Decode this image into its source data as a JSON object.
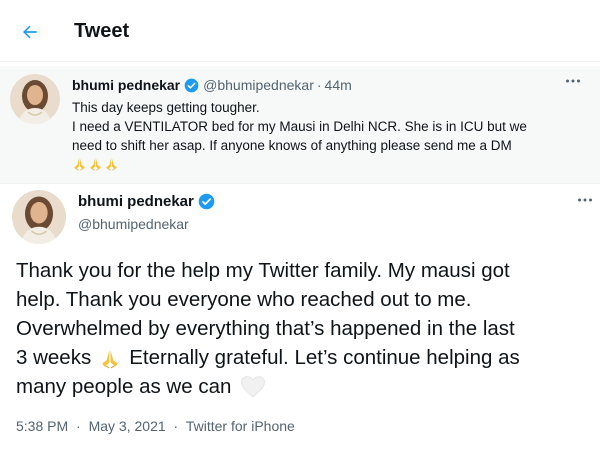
{
  "header": {
    "title": "Tweet",
    "back_icon": "arrow-left-icon"
  },
  "accent_color": "#1d9bf0",
  "parent_tweet": {
    "name": "bhumi pednekar",
    "handle": "@bhumipednekar",
    "separator": "·",
    "time": "44m",
    "lines": [
      "This day keeps getting tougher.",
      "I need a VENTILATOR bed for my Mausi in Delhi NCR. She is in ICU but we",
      "need to shift her asap. If anyone knows of anything please send me a DM"
    ],
    "emoji_icons": [
      "folded-hands-icon",
      "folded-hands-icon",
      "folded-hands-icon"
    ]
  },
  "main_tweet": {
    "name": "bhumi pednekar",
    "handle": "@bhumipednekar",
    "lines": [
      "Thank you for the help my Twitter family. My mausi got",
      "help. Thank you everyone who reached out to me.",
      "Overwhelmed by everything that’s happened in the last",
      "3 weeks",
      "Eternally grateful. Let’s continue helping as",
      "many people as we can"
    ],
    "emoji_icons": [
      "folded-hands-icon",
      "white-heart-icon"
    ],
    "time": "5:38 PM",
    "separator": "·",
    "date": "May 3, 2021",
    "source": "Twitter for iPhone"
  }
}
